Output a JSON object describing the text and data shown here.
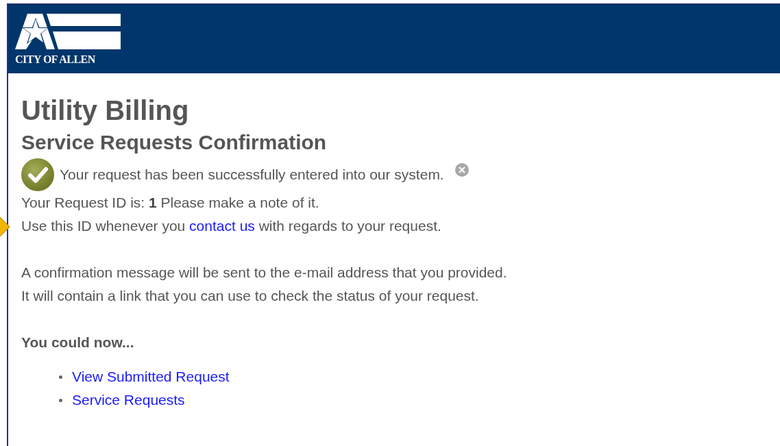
{
  "header": {
    "logo_text": "CITY OF ALLEN"
  },
  "title": "Utility Billing",
  "subtitle": "Service Requests Confirmation",
  "alert": {
    "message": "Your request has been successfully entered into our system.",
    "dismissible": true
  },
  "request_id_line": "Your Request ID is: **1** Please make a note of it.",
  "contact_line": {
    "before": "Use this ID whenever you",
    "link": "contact us",
    "after": "with regards to your request."
  },
  "confirmation_lines": [
    "A confirmation message will be sent to the e-mail address that you provided.",
    "It will contain a link that you can use to check the status of your request."
  ],
  "next_heading": "You could now...",
  "next_links": [
    "View Submitted Request",
    "Service Requests"
  ]
}
